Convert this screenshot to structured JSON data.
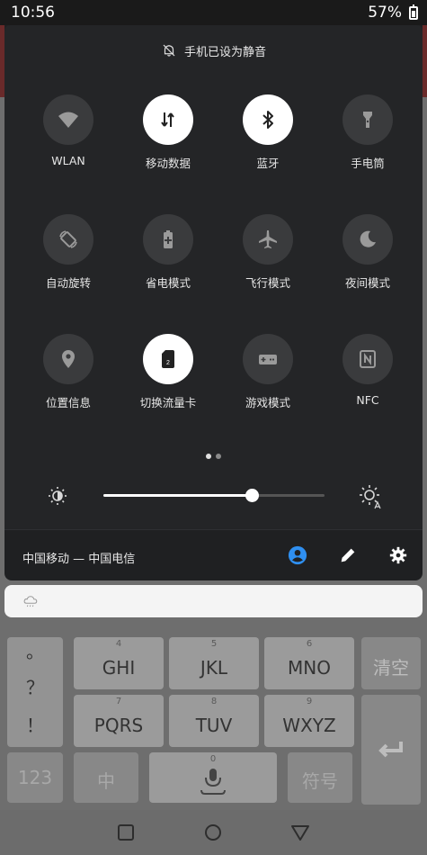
{
  "status_bar": {
    "time": "10:56",
    "battery": "57%"
  },
  "quick_settings": {
    "silent_text": "手机已设为静音",
    "tiles": [
      {
        "label": "WLAN",
        "icon": "wifi-icon",
        "on": false
      },
      {
        "label": "移动数据",
        "icon": "mobile-data-icon",
        "on": true
      },
      {
        "label": "蓝牙",
        "icon": "bluetooth-icon",
        "on": true
      },
      {
        "label": "手电筒",
        "icon": "flashlight-icon",
        "on": false
      },
      {
        "label": "自动旋转",
        "icon": "auto-rotate-icon",
        "on": false
      },
      {
        "label": "省电模式",
        "icon": "battery-saver-icon",
        "on": false
      },
      {
        "label": "飞行模式",
        "icon": "airplane-icon",
        "on": false
      },
      {
        "label": "夜间模式",
        "icon": "night-mode-icon",
        "on": false
      },
      {
        "label": "位置信息",
        "icon": "location-icon",
        "on": false
      },
      {
        "label": "切换流量卡",
        "icon": "sim-switch-icon",
        "on": true
      },
      {
        "label": "游戏模式",
        "icon": "game-mode-icon",
        "on": false
      },
      {
        "label": "NFC",
        "icon": "nfc-icon",
        "on": false
      }
    ],
    "page_indicator": {
      "pages": 2,
      "current": 1
    },
    "brightness": {
      "level": 0.67
    },
    "carrier_text": "中国移动 — 中国电信",
    "footer_icons": [
      "user-icon",
      "edit-icon",
      "settings-gear-icon"
    ]
  },
  "notification": {
    "icon": "weather-cloud-icon"
  },
  "keyboard": {
    "side_symbols": [
      "。",
      "？",
      "！"
    ],
    "rows": [
      [
        {
          "num": "4",
          "label": "GHI"
        },
        {
          "num": "5",
          "label": "JKL"
        },
        {
          "num": "6",
          "label": "MNO"
        }
      ],
      [
        {
          "num": "7",
          "label": "PQRS"
        },
        {
          "num": "8",
          "label": "TUV"
        },
        {
          "num": "9",
          "label": "WXYZ"
        }
      ]
    ],
    "clear_label": "清空",
    "num_mode_label": "123",
    "lang_label": "中",
    "space_num": "0",
    "symbol_label": "符号"
  },
  "colors": {
    "panel_bg": "#242527",
    "tile_off": "#3a3b3d",
    "tile_on": "#ffffff",
    "accent_blue": "#2f8ff0"
  }
}
